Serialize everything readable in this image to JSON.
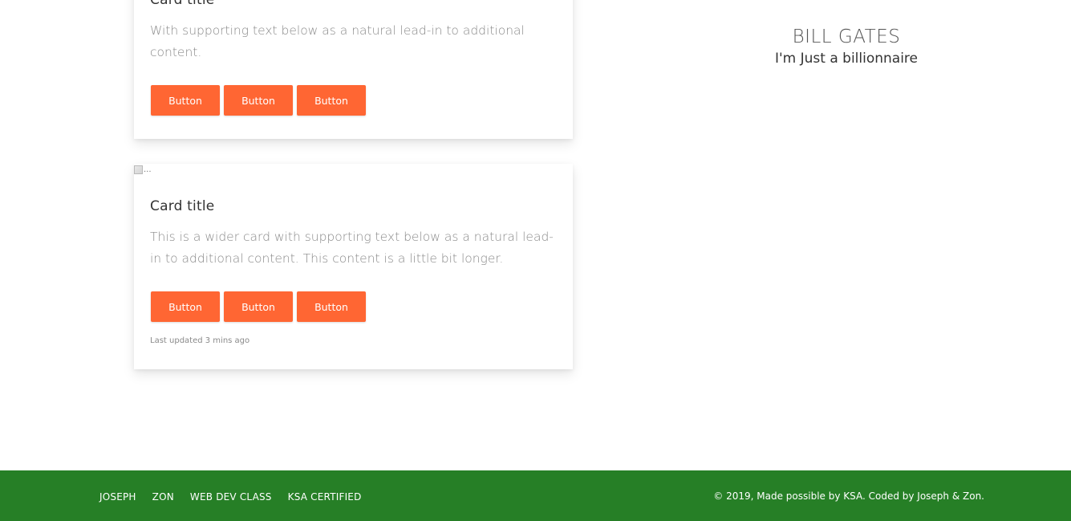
{
  "cards": [
    {
      "title": "Card title",
      "text": "With supporting text below as a natural lead-in to additional content.",
      "buttons": [
        "Button",
        "Button",
        "Button"
      ]
    },
    {
      "image_alt": "...",
      "title": "Card title",
      "text": "This is a wider card with supporting text below as a natural lead-in to additional content. This content is a little bit longer.",
      "buttons": [
        "Button",
        "Button",
        "Button"
      ],
      "meta": "Last updated 3 mins ago"
    }
  ],
  "profile": {
    "name": "BILL GATES",
    "tagline": "I'm Just a billionnaire"
  },
  "footer": {
    "links": [
      "JOSEPH",
      "ZON",
      "WEB DEV CLASS",
      "KSA CERTIFIED"
    ],
    "copyright": "© 2019, Made possible by KSA. Coded by Joseph & Zon."
  },
  "colors": {
    "button": "#ff6633",
    "footer": "#267f26"
  }
}
